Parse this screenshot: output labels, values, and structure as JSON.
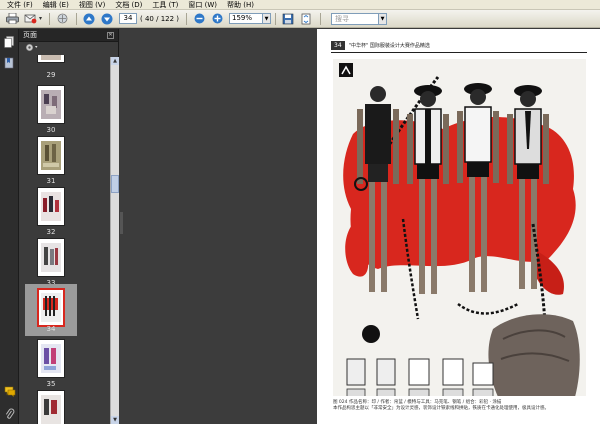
{
  "menu": [
    "文件 (F)",
    "编辑 (E)",
    "视图 (V)",
    "文档 (D)",
    "工具 (T)",
    "窗口 (W)",
    "帮助 (H)"
  ],
  "toolbar": {
    "current_page": "34",
    "page_count": "( 40 / 122 )",
    "zoom": "159%",
    "search_placeholder": "搜寻"
  },
  "panel": {
    "title": "页面"
  },
  "thumbnails": [
    {
      "label": "29"
    },
    {
      "label": "30"
    },
    {
      "label": "31"
    },
    {
      "label": "32"
    },
    {
      "label": "33"
    },
    {
      "label": "34",
      "selected": true
    },
    {
      "label": "35"
    }
  ],
  "page": {
    "number": "34",
    "title": "\"中华杯\" 国际服装设计大赛作品精选",
    "caption_line1": "图 024 作品名称：印 / 作者：帛蓝 / 模特与工具：马克笔、钢笔 / 组合：彩铅 · 涂描",
    "caption_line2": "本作品构思主题以「非常安全」为设计灵感，装饰设计铁索线和拼贴，铁质在卡通化处理使用，极具设计感。"
  },
  "colors": {
    "accent_red": "#d8271e",
    "ui_dark": "#3a3a3a"
  }
}
